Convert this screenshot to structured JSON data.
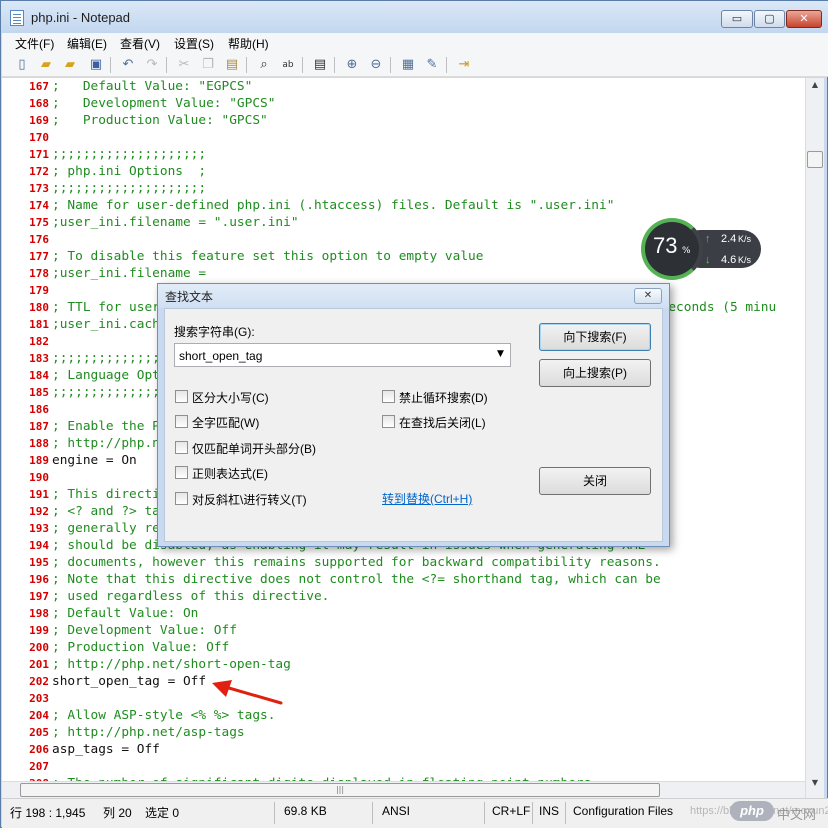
{
  "window": {
    "title": "php.ini - Notepad",
    "minimize_glyph": "▭",
    "maximize_glyph": "▢",
    "close_glyph": "✕"
  },
  "menu": [
    "文件(F)",
    "编辑(E)",
    "查看(V)",
    "设置(S)",
    "帮助(H)"
  ],
  "toolbar_icons": [
    "new-file-icon",
    "open-folder-icon",
    "open-recent-icon",
    "save-icon",
    "undo-icon",
    "redo-icon",
    "cut-icon",
    "copy-icon",
    "paste-icon",
    "find-icon",
    "replace-icon",
    "goto-icon",
    "zoom-in-icon",
    "zoom-out-icon",
    "view-icon",
    "edit-icon",
    "exit-icon"
  ],
  "editor": {
    "lines": [
      {
        "n": "167",
        "text": ";   Default Value: \"EGPCS\"",
        "kind": "comment"
      },
      {
        "n": "168",
        "text": ";   Development Value: \"GPCS\"",
        "kind": "comment"
      },
      {
        "n": "169",
        "text": ";   Production Value: \"GPCS\"",
        "kind": "comment"
      },
      {
        "n": "170",
        "text": "",
        "kind": "comment"
      },
      {
        "n": "171",
        "text": ";;;;;;;;;;;;;;;;;;;;",
        "kind": "comment"
      },
      {
        "n": "172",
        "text": "; php.ini Options  ;",
        "kind": "comment"
      },
      {
        "n": "173",
        "text": ";;;;;;;;;;;;;;;;;;;;",
        "kind": "comment"
      },
      {
        "n": "174",
        "text": "; Name for user-defined php.ini (.htaccess) files. Default is \".user.ini\"",
        "kind": "comment"
      },
      {
        "n": "175",
        "text": ";user_ini.filename = \".user.ini\"",
        "kind": "comment"
      },
      {
        "n": "176",
        "text": "",
        "kind": "comment"
      },
      {
        "n": "177",
        "text": "; To disable this feature set this option to empty value",
        "kind": "comment"
      },
      {
        "n": "178",
        "text": ";user_ini.filename =",
        "kind": "comment"
      },
      {
        "n": "179",
        "text": "",
        "kind": "comment"
      },
      {
        "n": "180",
        "text": "; TTL for user-defined php.ini files (time-to-live) in seconds. Default is 300 seconds (5 minu",
        "kind": "comment"
      },
      {
        "n": "181",
        "text": ";user_ini.cache_ttl = 300",
        "kind": "comment"
      },
      {
        "n": "182",
        "text": "",
        "kind": "comment"
      },
      {
        "n": "183",
        "text": ";;;;;;;;;;;;;;;;;;;;",
        "kind": "comment"
      },
      {
        "n": "184",
        "text": "; Language Options ;",
        "kind": "comment"
      },
      {
        "n": "185",
        "text": ";;;;;;;;;;;;;;;;;;;;",
        "kind": "comment"
      },
      {
        "n": "186",
        "text": "",
        "kind": "comment"
      },
      {
        "n": "187",
        "text": "; Enable the PHP scripting language engine under Apache.",
        "kind": "comment"
      },
      {
        "n": "188",
        "text": "; http://php.net/engine",
        "kind": "comment"
      },
      {
        "n": "189",
        "text": "engine = On",
        "kind": "plain"
      },
      {
        "n": "190",
        "text": "",
        "kind": "comment"
      },
      {
        "n": "191",
        "text": "; This directive determines whether or not PHP will recognize code between",
        "kind": "comment"
      },
      {
        "n": "192",
        "text": "; <? and ?> tags as PHP source which should be processed as such. It is",
        "kind": "comment"
      },
      {
        "n": "193",
        "text": "; generally recommended that <?php and ?> should be used and that this feature",
        "kind": "comment"
      },
      {
        "n": "194",
        "text": "; should be disabled, as enabling it may result in issues when generating XML",
        "kind": "comment"
      },
      {
        "n": "195",
        "text": "; documents, however this remains supported for backward compatibility reasons.",
        "kind": "comment"
      },
      {
        "n": "196",
        "text": "; Note that this directive does not control the <?= shorthand tag, which can be",
        "kind": "comment"
      },
      {
        "n": "197",
        "text": "; used regardless of this directive.",
        "kind": "comment"
      },
      {
        "n": "198",
        "text": "; Default Value: On",
        "kind": "comment"
      },
      {
        "n": "199",
        "text": "; Development Value: Off",
        "kind": "comment"
      },
      {
        "n": "200",
        "text": "; Production Value: Off",
        "kind": "comment"
      },
      {
        "n": "201",
        "text": "; http://php.net/short-open-tag",
        "kind": "comment"
      },
      {
        "n": "202",
        "text": "short_open_tag = Off",
        "kind": "plain"
      },
      {
        "n": "203",
        "text": "",
        "kind": "comment"
      },
      {
        "n": "204",
        "text": "; Allow ASP-style <% %> tags.",
        "kind": "comment"
      },
      {
        "n": "205",
        "text": "; http://php.net/asp-tags",
        "kind": "comment"
      },
      {
        "n": "206",
        "text": "asp_tags = Off",
        "kind": "plain"
      },
      {
        "n": "207",
        "text": "",
        "kind": "comment"
      },
      {
        "n": "208",
        "text": "; The number of significant digits displayed in floating point numbers.",
        "kind": "comment"
      }
    ]
  },
  "status": {
    "position": "行 198 : 1,945",
    "column": "列 20",
    "selected": "选定 0",
    "size": "69.8 KB",
    "encoding": "ANSI",
    "line_ending": "CR+LF",
    "mode": "INS",
    "file_type": "Configuration Files",
    "watermark": "https://blog.csdn.net/moxun201",
    "badge": "php",
    "badge_suffix": "中文网"
  },
  "find_dialog": {
    "title": "查找文本",
    "close_glyph": "✕",
    "search_label": "搜索字符串(G):",
    "search_value": "short_open_tag",
    "find_down": "向下搜索(F)",
    "find_up": "向上搜索(P)",
    "close": "关闭",
    "options": {
      "match_case": "区分大小写(C)",
      "whole_word": "全字匹配(W)",
      "word_start": "仅匹配单词开头部分(B)",
      "regex": "正则表达式(E)",
      "escape": "对反斜杠\\进行转义(T)",
      "no_wrap": "禁止循环搜索(D)",
      "close_after": "在查找后关闭(L)"
    },
    "replace_link": "转到替换(Ctrl+H)"
  },
  "speed_widget": {
    "cpu": "73",
    "cpu_unit": "%",
    "up": "2.4",
    "down": "4.6",
    "unit": "K/s",
    "up_glyph": "↑",
    "down_glyph": "↓"
  },
  "colors": {
    "line_number": "#d40000",
    "comment": "#1f8c1f",
    "plain": "#111111",
    "link": "#0066cc",
    "arrow": "#e02010"
  }
}
